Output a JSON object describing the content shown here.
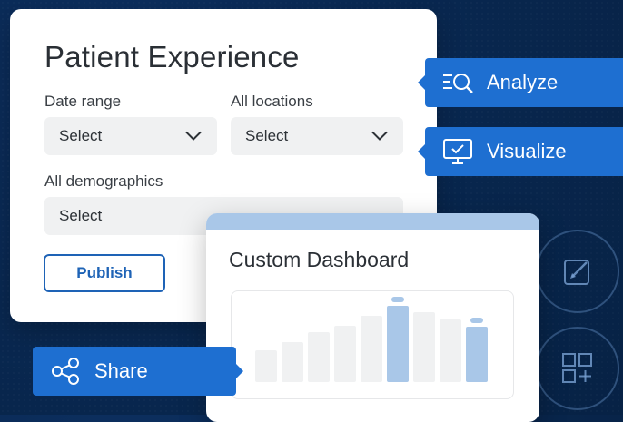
{
  "main_card": {
    "title": "Patient Experience",
    "date_range": {
      "label": "Date range",
      "value": "Select"
    },
    "locations": {
      "label": "All locations",
      "value": "Select"
    },
    "demographics": {
      "label": "All demographics",
      "value": "Select"
    },
    "publish_label": "Publish"
  },
  "actions": {
    "analyze": {
      "label": "Analyze",
      "icon": "analyze-search-icon"
    },
    "visualize": {
      "label": "Visualize",
      "icon": "monitor-check-icon"
    },
    "share": {
      "label": "Share",
      "icon": "share-icon"
    }
  },
  "dashboard": {
    "title": "Custom Dashboard"
  },
  "side_icons": [
    "edit-icon",
    "add-widget-icon"
  ],
  "colors": {
    "background": "#0a2a55",
    "accent_blue": "#1e6fd1",
    "publish_blue": "#1e63b6",
    "light_blue": "#a9c7e8",
    "card": "#ffffff",
    "select_bg": "#f0f1f2"
  },
  "chart_bars": [
    {
      "value": 0.32,
      "highlight": false
    },
    {
      "value": 0.4,
      "highlight": false
    },
    {
      "value": 0.5,
      "highlight": false
    },
    {
      "value": 0.56,
      "highlight": false
    },
    {
      "value": 0.66,
      "highlight": false
    },
    {
      "value": 0.76,
      "highlight": true
    },
    {
      "value": 0.7,
      "highlight": false
    },
    {
      "value": 0.63,
      "highlight": false
    },
    {
      "value": 0.55,
      "highlight": true
    }
  ]
}
